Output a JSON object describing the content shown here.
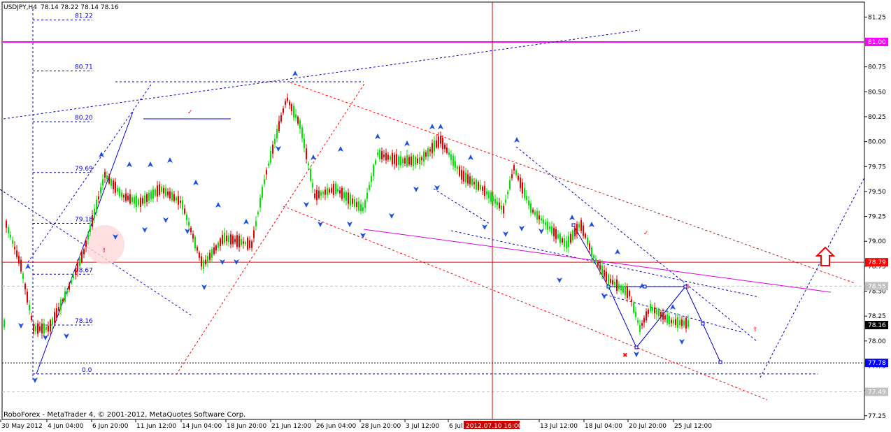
{
  "header": {
    "symbol": "USDJPY,H4",
    "ohlc": "78.14 78.22 78.14 78.16"
  },
  "footer": {
    "copyright": "RoboForex - MetaTrader 4, © 2001-2012, MetaQuotes Software Corp."
  },
  "chart_data": {
    "type": "candlestick",
    "ylim": [
      77.16,
      81.42
    ],
    "y_ticks": [
      "81.25",
      "80.75",
      "80.50",
      "80.25",
      "80.00",
      "79.75",
      "79.50",
      "79.25",
      "79.00",
      "78.75",
      "78.50",
      "78.25",
      "78.00",
      "77.75",
      "77.50",
      "77.25"
    ],
    "price_labels": [
      {
        "text": "81.00",
        "value": 81.0,
        "bg": "#ff00ff"
      },
      {
        "text": "78.79",
        "value": 78.79,
        "bg": "#ff0000"
      },
      {
        "text": "78.55",
        "value": 78.55,
        "bg": "#c0c0c0"
      },
      {
        "text": "78.16",
        "value": 78.16,
        "bg": "#000000"
      },
      {
        "text": "77.78",
        "value": 77.78,
        "bg": "#0000ff"
      },
      {
        "text": "77.49",
        "value": 77.49,
        "bg": "#c0c0c0"
      }
    ],
    "x_ticks": [
      "30 May 2012",
      "4 Jun 04:00",
      "6 Jun 20:00",
      "11 Jun 12:00",
      "14 Jun 04:00",
      "18 Jun 20:00",
      "21 Jun 12:00",
      "26 Jun 04:00",
      "28 Jun 20:00",
      "3 Jul 12:00",
      "6 Jul",
      "2012.07.10 16:00",
      "13 Jul 12:00",
      "18 Jul 04:00",
      "20 Jul 20:00",
      "25 Jul 12:00"
    ],
    "fib_levels": [
      {
        "label": "81.22",
        "value": 81.22
      },
      {
        "label": "80.71",
        "value": 80.71
      },
      {
        "label": "80.20",
        "value": 80.2
      },
      {
        "label": "79.69",
        "value": 79.69
      },
      {
        "label": "79.18",
        "value": 79.18
      },
      {
        "label": "78.67",
        "value": 78.67
      },
      {
        "label": "78.16",
        "value": 78.16
      },
      {
        "label": "0.0",
        "value": 77.67
      }
    ],
    "colors": {
      "bull": "#00e600",
      "bear": "#e60000",
      "fib": "#0000cc",
      "pivot": "#ff00ff",
      "trend": "#ff0000"
    }
  }
}
